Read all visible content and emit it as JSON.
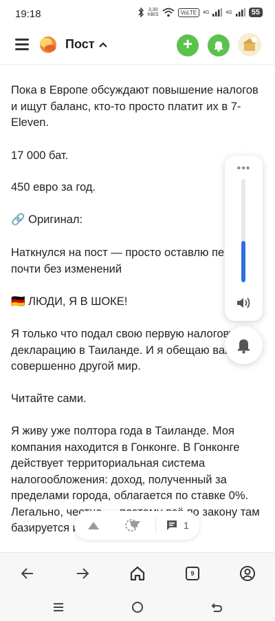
{
  "status_bar": {
    "time": "19:18",
    "net_speed_value": "3,30",
    "net_speed_unit": "KB/S",
    "volte": "VoLTE",
    "signal1_label": "4G",
    "signal2_label": "4G",
    "battery": "55"
  },
  "header": {
    "title": "Пост",
    "add_label": "+"
  },
  "post": {
    "paragraphs": [
      "Пока в Европе обсуждают повышение налогов и ищут баланс, кто-то просто платит их в 7-Eleven.",
      "17 000 бат.",
      "450 евро за год.",
      "🔗 Оригинал:",
      "Наткнулся на пост — просто оставлю перевод почти без изменений",
      "🇩🇪 ЛЮДИ, Я В ШОКЕ!",
      "Я только что подал свою первую налоговую декларацию в Таиланде. И я обещаю вам совершенно другой мир.",
      "Читайте сами.",
      "Я живу уже полтора года в Таиланде. Моя компания находится в Гонконге. В Гонконге действует территориальная система налогообложения: доход, полученный за пределами города, облагается по ставке 0%. Легально, честно — поэтому всё по закону там базируется и работает."
    ]
  },
  "volume_panel": {
    "dots": "•••",
    "level": 0.4
  },
  "nav_pill": {
    "comments_count": "1"
  },
  "toolbar": {
    "tabs_count": "9"
  },
  "colors": {
    "accent_green": "#5cc24e",
    "volume_blue": "#2f6fe0"
  }
}
